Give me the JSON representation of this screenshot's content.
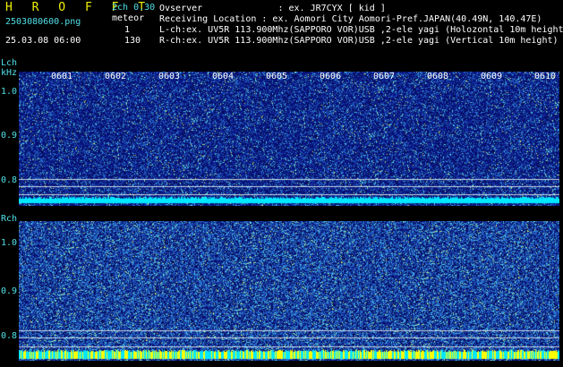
{
  "header": {
    "app_name": "H R O F F T",
    "version": "2ch 0.30",
    "filename": "2503080600.png",
    "meteor_label": "meteor",
    "datetime": "25.03.08 06:00",
    "meteor_lch_count": "1",
    "meteor_rch_count": "130"
  },
  "info": {
    "observer": "Ovserver              : ex. JR7CYX [ kid ]",
    "location": "Receiving Location : ex. Aomori City Aomori-Pref.JAPAN(40.49N, 140.47E)",
    "lch": "L-ch:ex. UV5R 113.900Mhz(SAPPORO VOR)USB ,2-ele yagi (Holozontal 10m height)",
    "rch": "R-ch:ex. UV5R 113.900Mhz(SAPPORO VOR)USB ,2-ele yagi (Vertical 10m height)"
  },
  "lch": {
    "label": "Lch",
    "unit": "kHz",
    "y_ticks": [
      "1.0",
      "0.9",
      "0.8"
    ],
    "time_labels": [
      "0601",
      "0602",
      "0603",
      "0604",
      "0605",
      "0606",
      "0607",
      "0608",
      "0609",
      "0610"
    ]
  },
  "rch": {
    "label": "Rch",
    "y_ticks": [
      "1.0",
      "0.9",
      "0.8"
    ]
  },
  "colors": {
    "background": "#000000",
    "label_cyan": "#4ee0e8",
    "noise_bg": "#101a70",
    "baseline_cyan": "#00e8ff",
    "baseline_yellow": "#ffff00"
  }
}
